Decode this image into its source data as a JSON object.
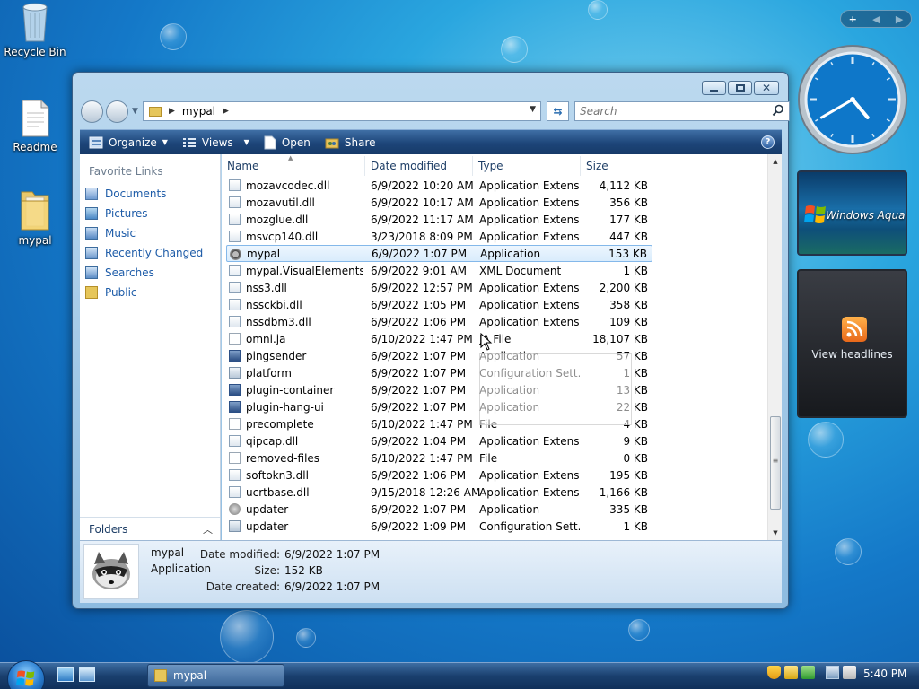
{
  "desktop": {
    "icons": [
      {
        "label": "Recycle Bin"
      },
      {
        "label": "Readme"
      },
      {
        "label": "mypal"
      }
    ]
  },
  "window": {
    "address": {
      "crumb": "mypal"
    },
    "search": {
      "placeholder": "Search"
    },
    "toolbar": {
      "organize": "Organize",
      "views": "Views",
      "open": "Open",
      "share": "Share"
    },
    "nav": {
      "title": "Favorite Links",
      "links": [
        "Documents",
        "Pictures",
        "Music",
        "Recently Changed",
        "Searches",
        "Public"
      ],
      "folders": "Folders"
    },
    "columns": {
      "name": "Name",
      "date": "Date modified",
      "type": "Type",
      "size": "Size"
    },
    "files": [
      {
        "name": "mozavcodec.dll",
        "date": "6/9/2022 10:20 AM",
        "type": "Application Extens...",
        "size": "4,112 KB",
        "icon": "dll-icon"
      },
      {
        "name": "mozavutil.dll",
        "date": "6/9/2022 10:17 AM",
        "type": "Application Extens...",
        "size": "356 KB",
        "icon": "dll-icon"
      },
      {
        "name": "mozglue.dll",
        "date": "6/9/2022 11:17 AM",
        "type": "Application Extens...",
        "size": "177 KB",
        "icon": "dll-icon"
      },
      {
        "name": "msvcp140.dll",
        "date": "3/23/2018 8:09 PM",
        "type": "Application Extens...",
        "size": "447 KB",
        "icon": "dll-icon"
      },
      {
        "name": "mypal",
        "date": "6/9/2022 1:07 PM",
        "type": "Application",
        "size": "153 KB",
        "icon": "raccoon-icon",
        "selected": true
      },
      {
        "name": "mypal.VisualElements...",
        "date": "6/9/2022 9:01 AM",
        "type": "XML Document",
        "size": "1 KB",
        "icon": "xml-icon"
      },
      {
        "name": "nss3.dll",
        "date": "6/9/2022 12:57 PM",
        "type": "Application Extens...",
        "size": "2,200 KB",
        "icon": "dll-icon"
      },
      {
        "name": "nssckbi.dll",
        "date": "6/9/2022 1:05 PM",
        "type": "Application Extens...",
        "size": "358 KB",
        "icon": "dll-icon"
      },
      {
        "name": "nssdbm3.dll",
        "date": "6/9/2022 1:06 PM",
        "type": "Application Extens...",
        "size": "109 KB",
        "icon": "dll-icon"
      },
      {
        "name": "omni.ja",
        "date": "6/10/2022 1:47 PM",
        "type": "JA File",
        "size": "18,107 KB",
        "icon": "file-icon"
      },
      {
        "name": "pingsender",
        "date": "6/9/2022 1:07 PM",
        "type": "Application",
        "size": "57 KB",
        "icon": "app-icon"
      },
      {
        "name": "platform",
        "date": "6/9/2022 1:07 PM",
        "type": "Configuration Sett...",
        "size": "1 KB",
        "icon": "config-icon"
      },
      {
        "name": "plugin-container",
        "date": "6/9/2022 1:07 PM",
        "type": "Application",
        "size": "13 KB",
        "icon": "app-icon"
      },
      {
        "name": "plugin-hang-ui",
        "date": "6/9/2022 1:07 PM",
        "type": "Application",
        "size": "22 KB",
        "icon": "app-icon"
      },
      {
        "name": "precomplete",
        "date": "6/10/2022 1:47 PM",
        "type": "File",
        "size": "4 KB",
        "icon": "file-icon"
      },
      {
        "name": "qipcap.dll",
        "date": "6/9/2022 1:04 PM",
        "type": "Application Extens...",
        "size": "9 KB",
        "icon": "dll-icon"
      },
      {
        "name": "removed-files",
        "date": "6/10/2022 1:47 PM",
        "type": "File",
        "size": "0 KB",
        "icon": "file-icon"
      },
      {
        "name": "softokn3.dll",
        "date": "6/9/2022 1:06 PM",
        "type": "Application Extens...",
        "size": "195 KB",
        "icon": "dll-icon"
      },
      {
        "name": "ucrtbase.dll",
        "date": "9/15/2018 12:26 AM",
        "type": "Application Extens...",
        "size": "1,166 KB",
        "icon": "dll-icon"
      },
      {
        "name": "updater",
        "date": "6/9/2022 1:07 PM",
        "type": "Application",
        "size": "335 KB",
        "icon": "updater-icon"
      },
      {
        "name": "updater",
        "date": "6/9/2022 1:09 PM",
        "type": "Configuration Sett...",
        "size": "1 KB",
        "icon": "config-icon"
      }
    ],
    "details": {
      "name": "mypal",
      "type": "Application",
      "modified_label": "Date modified:",
      "modified": "6/9/2022 1:07 PM",
      "size_label": "Size:",
      "size": "152 KB",
      "created_label": "Date created:",
      "created": "6/9/2022 1:07 PM"
    }
  },
  "gadgets": {
    "slideshow_text": "Windows Aqua",
    "feed_text": "View headlines",
    "clock": {
      "hour": 4,
      "minute": 40
    }
  },
  "taskbar": {
    "task_label": "mypal",
    "time": "5:40 PM"
  }
}
